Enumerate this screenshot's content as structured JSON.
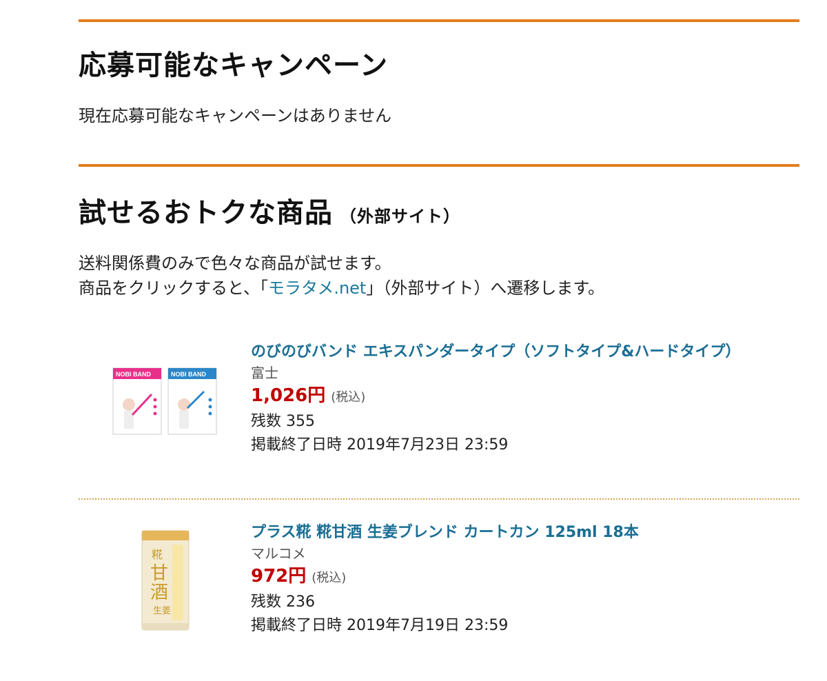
{
  "campaign": {
    "title": "応募可能なキャンペーン",
    "message": "現在応募可能なキャンペーンはありません"
  },
  "trial": {
    "title": "試せるおトクな商品",
    "title_suffix": "（外部サイト）",
    "desc_line1": "送料関係費のみで色々な商品が試せます。",
    "desc_line2_prefix": "商品をクリックすると、「",
    "desc_link": "モラタメ.net",
    "desc_line2_suffix": "」（外部サイト）へ遷移します。"
  },
  "products": [
    {
      "name": "のびのびバンド エキスパンダータイプ（ソフトタイプ&ハードタイプ）",
      "maker": "富士",
      "price": "1,026円",
      "tax_label": "(税込)",
      "stock": "残数 355",
      "end_date": "掲載終了日時 2019年7月23日 23:59",
      "image_label": "NOBI BAND"
    },
    {
      "name": "プラス糀 糀甘酒 生姜ブレンド カートカン 125ml 18本",
      "maker": "マルコメ",
      "price": "972円",
      "tax_label": "(税込)",
      "stock": "残数 236",
      "end_date": "掲載終了日時 2019年7月19日 23:59",
      "image_label": "糀甘酒 生姜ブレンド"
    }
  ]
}
